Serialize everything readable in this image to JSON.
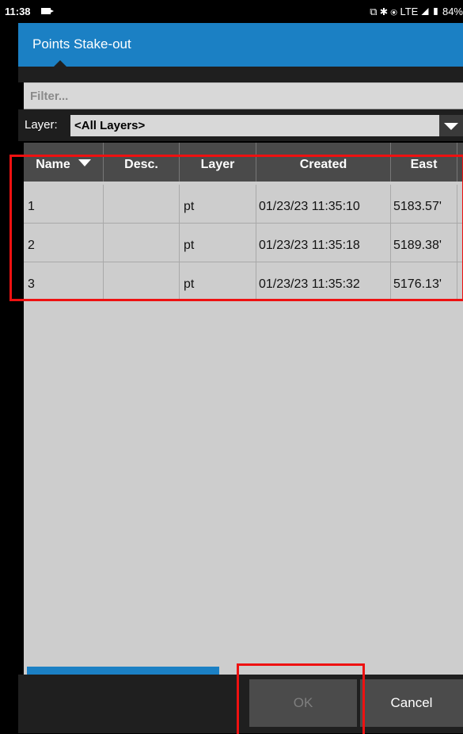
{
  "status_bar": {
    "time": "11:38",
    "indicators": "⧉ ✱ ⦿ LTE ◢ ▮ 84%",
    "icons": [
      "camera-icon",
      "cast-icon",
      "bluetooth-icon",
      "vibrate-icon",
      "signal-icon",
      "battery-icon"
    ]
  },
  "app_bar": {
    "title": "Points Stake-out"
  },
  "filter": {
    "placeholder": "Filter..."
  },
  "layer": {
    "label": "Layer:",
    "selected": "<All Layers>"
  },
  "table": {
    "headers": [
      "Name",
      "Desc.",
      "Layer",
      "Created",
      "East"
    ],
    "rows": [
      [
        "1",
        "",
        "pt",
        "01/23/23 11:35:10",
        "5183.57'"
      ],
      [
        "2",
        "",
        "pt",
        "01/23/23 11:35:18",
        "5189.38'"
      ],
      [
        "3",
        "",
        "pt",
        "01/23/23 11:35:32",
        "5176.13'"
      ]
    ]
  },
  "scroll": {
    "horizontal_position": 0.44
  },
  "buttons": {
    "ok": "OK",
    "cancel": "Cancel"
  },
  "colors": {
    "accent": "#1b80c4",
    "highlight": "#ee1111",
    "header_bg": "#4a4a4a",
    "grid_bg": "#cdcdcd"
  }
}
